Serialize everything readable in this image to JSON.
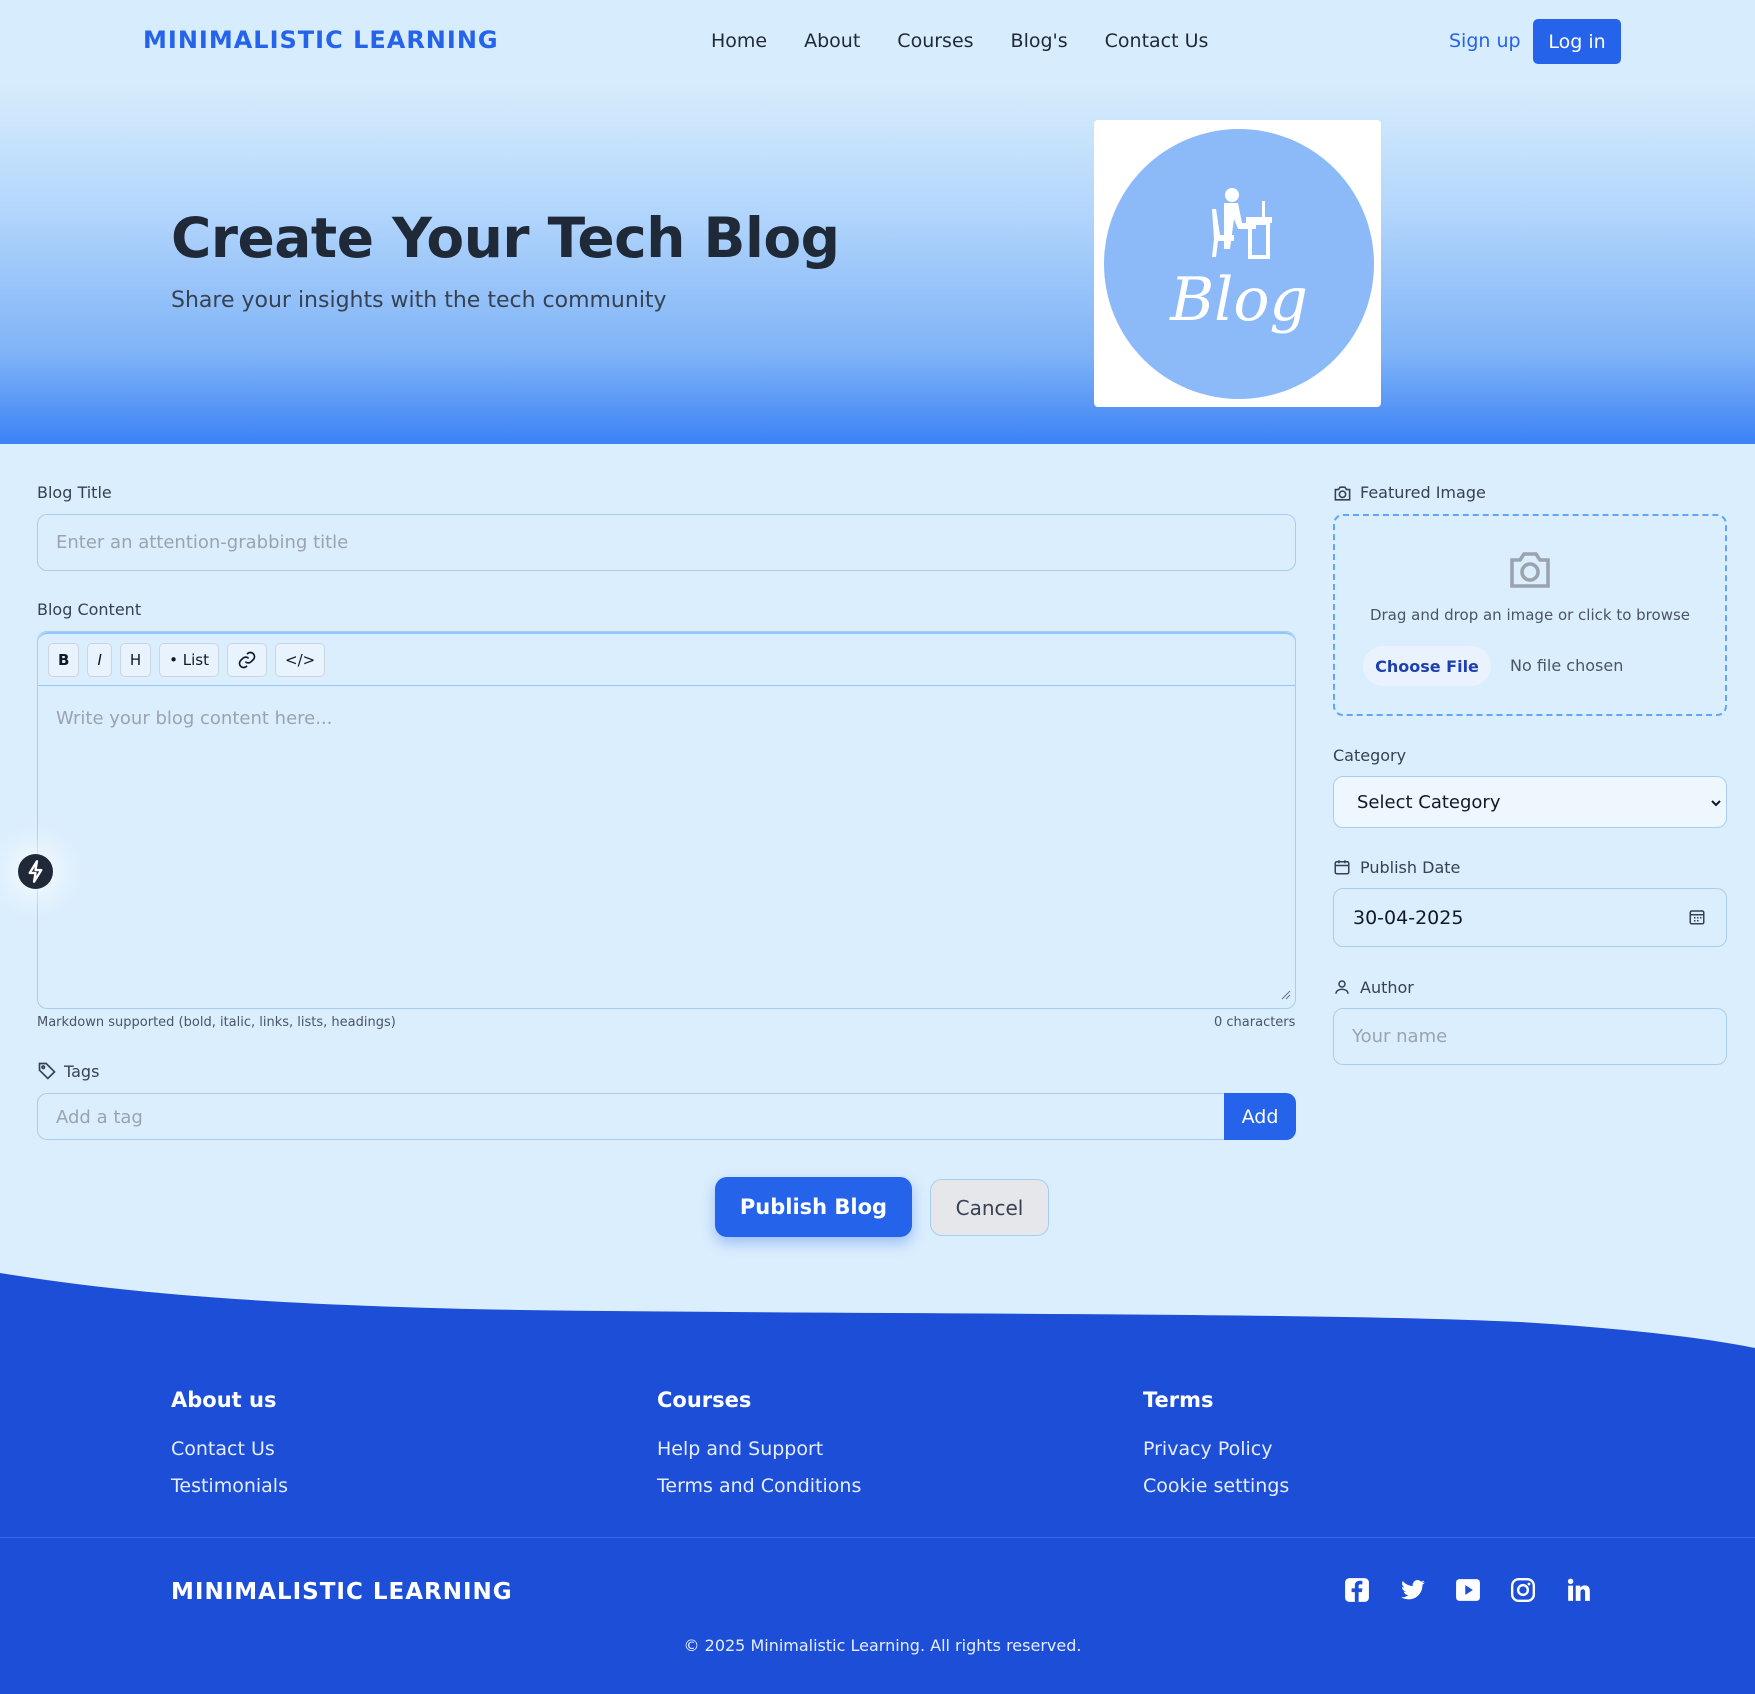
{
  "header": {
    "brand": "MINIMALISTIC LEARNING",
    "nav": [
      "Home",
      "About",
      "Courses",
      "Blog's",
      "Contact Us"
    ],
    "signup": "Sign up",
    "login": "Log in"
  },
  "hero": {
    "title": "Create Your Tech Blog",
    "subtitle": "Share your insights with the tech community",
    "image_text": "Blog"
  },
  "form": {
    "title_label": "Blog Title",
    "title_placeholder": "Enter an attention-grabbing title",
    "content_label": "Blog Content",
    "toolbar": [
      "B",
      "I",
      "H",
      "• List",
      "link-icon",
      "</>"
    ],
    "content_placeholder": "Write your blog content here...",
    "markdown_note": "Markdown supported (bold, italic, links, lists, headings)",
    "char_count": "0 characters",
    "tags_label": "Tags",
    "tags_placeholder": "Add a tag",
    "add_button": "Add",
    "publish_button": "Publish Blog",
    "cancel_button": "Cancel"
  },
  "sidebar": {
    "featured_label": "Featured Image",
    "dropzone_text": "Drag and drop an image or click to browse",
    "choose_file": "Choose File",
    "no_file": "No file chosen",
    "category_label": "Category",
    "category_value": "Select Category",
    "date_label": "Publish Date",
    "date_value": "30-04-2025",
    "author_label": "Author",
    "author_placeholder": "Your name"
  },
  "footer": {
    "columns": [
      {
        "title": "About us",
        "links": [
          "Contact Us",
          "Testimonials"
        ]
      },
      {
        "title": "Courses",
        "links": [
          "Help and Support",
          "Terms and Conditions"
        ]
      },
      {
        "title": "Terms",
        "links": [
          "Privacy Policy",
          "Cookie settings"
        ]
      }
    ],
    "brand": "MINIMALISTIC LEARNING",
    "social": [
      "facebook-icon",
      "twitter-icon",
      "youtube-icon",
      "instagram-icon",
      "linkedin-icon"
    ],
    "copyright": "© 2025 Minimalistic Learning. All rights reserved."
  },
  "colors": {
    "primary": "#2563eb",
    "footer": "#1d4ed8",
    "page_bg": "#dbeefd"
  }
}
